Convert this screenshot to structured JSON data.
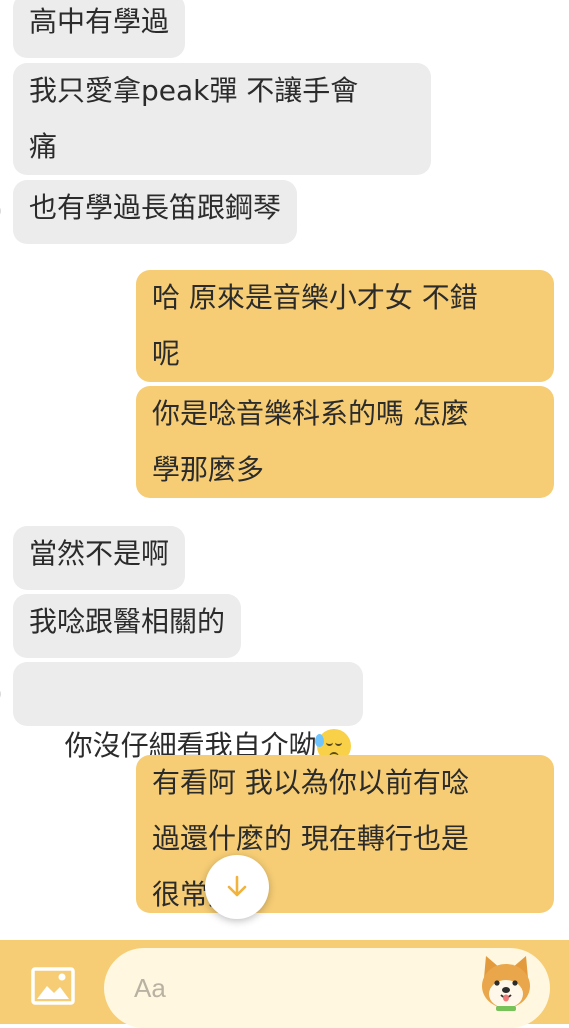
{
  "messages": [
    {
      "side": "in",
      "text": "高中有學過"
    },
    {
      "side": "in",
      "text": "我只愛拿peak彈 不讓手會\n痛"
    },
    {
      "side": "in",
      "text": "也有學過長笛跟鋼琴"
    },
    {
      "side": "out",
      "text": "哈 原來是音樂小才女 不錯\n呢"
    },
    {
      "side": "out",
      "text": "你是唸音樂科系的嗎 怎麼\n學那麼多"
    },
    {
      "side": "in",
      "text": "當然不是啊"
    },
    {
      "side": "in",
      "text": "我唸跟醫相關的"
    },
    {
      "side": "in",
      "text": "你沒仔細看我自介呦",
      "emoji": "downcast-face-with-sweat"
    },
    {
      "side": "out",
      "text": "有看阿 我以為你以前有唸\n過還什麼的 現在轉行也是\n很常見阿"
    }
  ],
  "composer": {
    "placeholder": "Aa"
  },
  "icons": {
    "scroll_down": "arrow-down-icon",
    "image": "image-icon",
    "sticker": "shiba-sticker-icon"
  },
  "colors": {
    "outgoing": "#f6cd75",
    "incoming": "#ececec",
    "bar": "#f6cd75",
    "accent": "#f2b33d"
  }
}
